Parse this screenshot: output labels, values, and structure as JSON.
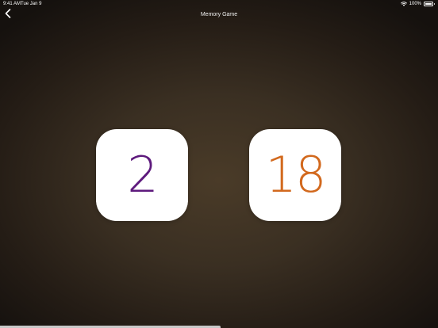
{
  "status_bar": {
    "time": "9:41 AM",
    "date": "Tue Jan 9",
    "battery": "100%"
  },
  "nav": {
    "title": "Memory Game"
  },
  "cards": [
    {
      "value": "2",
      "color": "#5e1a7d"
    },
    {
      "value": "18",
      "color": "#d2691e"
    }
  ],
  "icons": {
    "back": "chevron-left-icon",
    "wifi": "wifi-icon",
    "battery": "battery-icon"
  }
}
